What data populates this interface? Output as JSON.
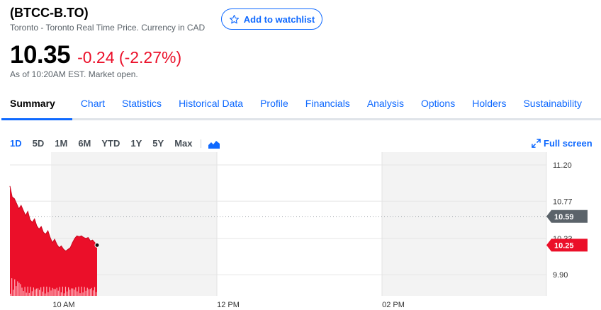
{
  "header": {
    "ticker": "(BTCC-B.TO)",
    "subtitle": "Toronto - Toronto Real Time Price. Currency in CAD",
    "watchlist_label": "Add to watchlist"
  },
  "quote": {
    "price": "10.35",
    "change": "-0.24 (-2.27%)",
    "as_of": "As of 10:20AM EST. Market open."
  },
  "tabs": [
    {
      "label": "Summary",
      "active": true
    },
    {
      "label": "Chart"
    },
    {
      "label": "Statistics"
    },
    {
      "label": "Historical Data"
    },
    {
      "label": "Profile"
    },
    {
      "label": "Financials"
    },
    {
      "label": "Analysis"
    },
    {
      "label": "Options"
    },
    {
      "label": "Holders"
    },
    {
      "label": "Sustainability"
    }
  ],
  "ranges": [
    "1D",
    "5D",
    "1M",
    "6M",
    "YTD",
    "1Y",
    "5Y",
    "Max"
  ],
  "active_range": "1D",
  "fullscreen_label": "Full screen",
  "colors": {
    "accent": "#0f69ff",
    "down": "#eb0f29",
    "prev_close_tag": "#5b636a"
  },
  "chart_data": {
    "type": "area",
    "y_ticks": [
      "11.20",
      "10.77",
      "10.33",
      "9.90"
    ],
    "x_ticks": [
      "10 AM",
      "12 PM",
      "02 PM"
    ],
    "ylim": [
      9.7,
      11.3
    ],
    "previous_close": "10.59",
    "current": "10.25",
    "series": [
      {
        "values": [
          10.95,
          10.82,
          10.8,
          10.74,
          10.68,
          10.72,
          10.66,
          10.6,
          10.65,
          10.55,
          10.52,
          10.56,
          10.48,
          10.44,
          10.47,
          10.4,
          10.38,
          10.42,
          10.34,
          10.28,
          10.32,
          10.26,
          10.22,
          10.24,
          10.2,
          10.18,
          10.2,
          10.22,
          10.28,
          10.33,
          10.36,
          10.35,
          10.36,
          10.34,
          10.33,
          10.34,
          10.3,
          10.31,
          10.28,
          10.25
        ]
      }
    ]
  }
}
